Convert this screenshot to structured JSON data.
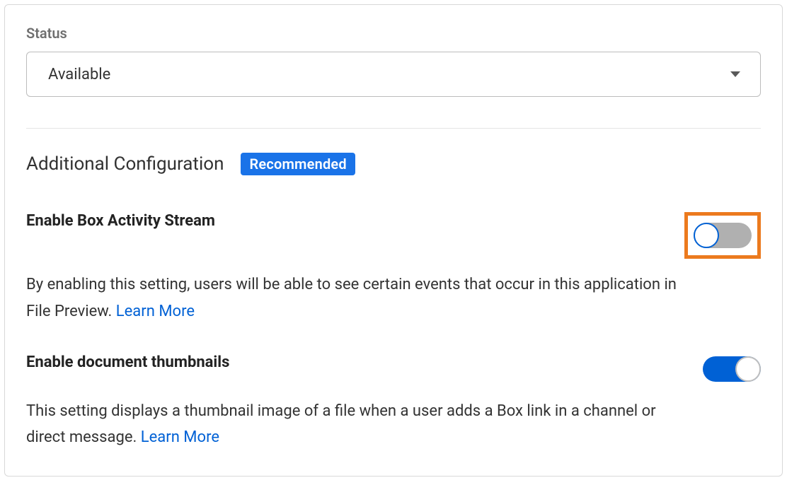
{
  "status": {
    "label": "Status",
    "selected": "Available"
  },
  "section": {
    "title": "Additional Configuration",
    "badge": "Recommended"
  },
  "settings": [
    {
      "title": "Enable Box Activity Stream",
      "description_prefix": "By enabling this setting, users will be able to see certain events that occur in this application in File Preview. ",
      "learn_more": "Learn More",
      "toggle_on": false,
      "highlighted": true
    },
    {
      "title": "Enable document thumbnails",
      "description_prefix": "This setting displays a thumbnail image of a file when a user adds a Box link in a channel or direct message. ",
      "learn_more": "Learn More",
      "toggle_on": true,
      "highlighted": false
    }
  ]
}
